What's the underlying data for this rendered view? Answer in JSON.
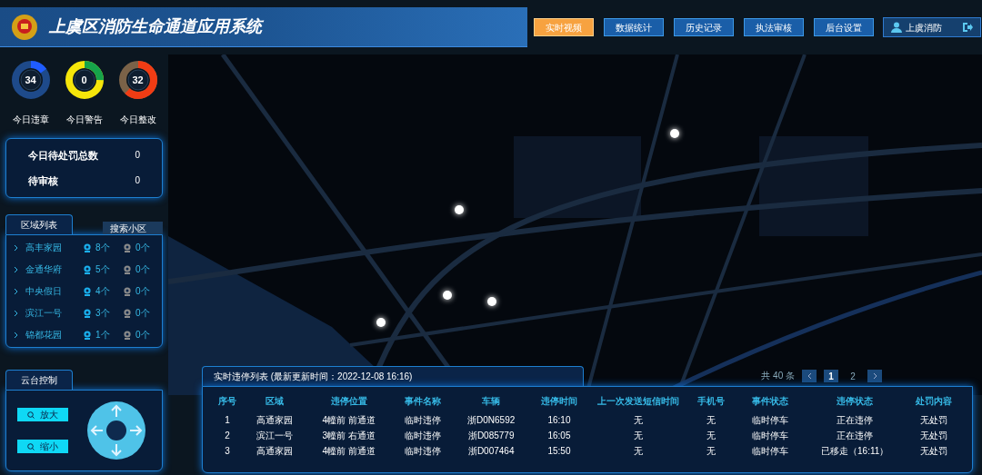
{
  "header": {
    "title": "上虞区消防生命通道应用系统",
    "nav": [
      {
        "label": "实时视频",
        "selected": true
      },
      {
        "label": "数据统计",
        "selected": false
      },
      {
        "label": "历史记录",
        "selected": false
      },
      {
        "label": "执法审核",
        "selected": false
      },
      {
        "label": "后台设置",
        "selected": false
      }
    ],
    "user": "上虞消防"
  },
  "stats": [
    {
      "value": "34",
      "label": "今日违章"
    },
    {
      "value": "0",
      "label": "今日警告"
    },
    {
      "value": "32",
      "label": "今日整改"
    }
  ],
  "pending": [
    {
      "label": "今日待处罚总数",
      "value": "0"
    },
    {
      "label": "待审核",
      "value": "0"
    }
  ],
  "region_list": {
    "title": "区域列表",
    "search_placeholder": "搜索小区",
    "items": [
      {
        "name": "高丰家园",
        "online": "8个",
        "offline": "0个"
      },
      {
        "name": "金通华府",
        "online": "5个",
        "offline": "0个"
      },
      {
        "name": "中央假日",
        "online": "4个",
        "offline": "0个"
      },
      {
        "name": "滨江一号",
        "online": "3个",
        "offline": "0个"
      },
      {
        "name": "锦都花园",
        "online": "1个",
        "offline": "0个"
      }
    ]
  },
  "ptz": {
    "title": "云台控制",
    "buttons": [
      "放大",
      "缩小"
    ]
  },
  "table": {
    "title": "实时违停列表 (最新更新时间：2022-12-08 16:16)",
    "total": "共 40 条",
    "pages": [
      {
        "label": "1",
        "selected": true
      },
      {
        "label": "2",
        "selected": false
      }
    ],
    "columns": [
      "序号",
      "区域",
      "违停位置",
      "事件名称",
      "车辆",
      "违停时间",
      "上一次发送短信时间",
      "手机号",
      "事件状态",
      "违停状态",
      "处罚内容"
    ],
    "rows": [
      [
        "1",
        "高通家园",
        "4幢前 前通道",
        "临时违停",
        "浙D0N6592",
        "16:10",
        "无",
        "无",
        "临时停车",
        "正在违停",
        "无处罚"
      ],
      [
        "2",
        "滨江一号",
        "3幢前 右通道",
        "临时违停",
        "浙D085779",
        "16:05",
        "无",
        "无",
        "临时停车",
        "正在违停",
        "无处罚"
      ],
      [
        "3",
        "高通家园",
        "4幢前 前通道",
        "临时违停",
        "浙D007464",
        "15:50",
        "无",
        "无",
        "临时停车",
        "已移走（16:11）",
        "无处罚"
      ]
    ]
  }
}
